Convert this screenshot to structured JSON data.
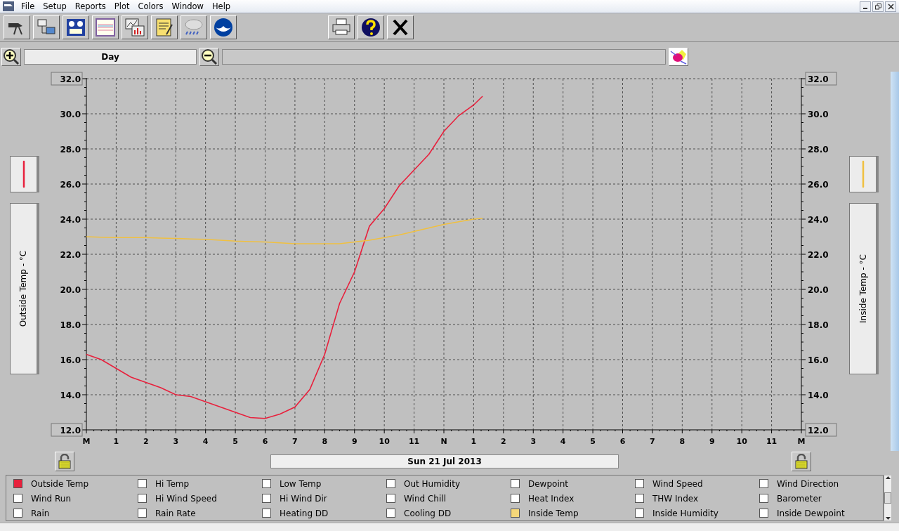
{
  "menu": [
    "File",
    "Setup",
    "Reports",
    "Plot",
    "Colors",
    "Window",
    "Help"
  ],
  "zoom_bar": {
    "period": "Day"
  },
  "left_axis": {
    "title": "Outside Temp - °C"
  },
  "right_axis": {
    "title": "Inside Temp - °C",
    "ticks": [
      "32.0",
      "30.0",
      "28.0",
      "26.0",
      "24.0",
      "22.0",
      "20.0",
      "18.0",
      "16.0",
      "14.0",
      "12.0"
    ]
  },
  "chart_data": {
    "type": "line",
    "x": [
      0,
      0.5,
      1,
      1.5,
      2,
      2.5,
      3,
      3.5,
      4,
      4.5,
      5,
      5.5,
      6,
      6.5,
      7,
      7.5,
      8,
      8.5,
      9,
      9.5,
      10,
      10.5,
      11,
      11.5,
      12,
      12.5,
      13,
      13.3
    ],
    "series": [
      {
        "color": "#e8203c",
        "values": [
          16.3,
          16.0,
          15.5,
          15.0,
          14.7,
          14.4,
          14.0,
          13.9,
          13.6,
          13.3,
          13.0,
          12.7,
          12.65,
          12.9,
          13.3,
          14.3,
          16.3,
          19.2,
          21.0,
          23.6,
          24.6,
          25.9,
          26.8,
          27.7,
          29.0,
          29.9,
          30.5,
          31.0
        ]
      },
      {
        "color": "#f0c040",
        "values": [
          23.0,
          22.97,
          22.95,
          22.95,
          22.95,
          22.92,
          22.9,
          22.87,
          22.85,
          22.8,
          22.75,
          22.72,
          22.7,
          22.65,
          22.6,
          22.6,
          22.6,
          22.6,
          22.7,
          22.8,
          22.95,
          23.1,
          23.3,
          23.5,
          23.7,
          23.85,
          24.0,
          24.05
        ]
      }
    ],
    "xlim": [
      0,
      24
    ],
    "ylim": [
      12,
      32
    ],
    "grid": true,
    "xticks": [
      1,
      2,
      3,
      4,
      5,
      6,
      7,
      8,
      9,
      10,
      11
    ],
    "yticks": [
      {
        "value": 32,
        "label": "32.0"
      },
      {
        "value": 30,
        "label": "30.0"
      },
      {
        "value": 28,
        "label": "28.0"
      },
      {
        "value": 26,
        "label": "26.0"
      },
      {
        "value": 24,
        "label": "24.0"
      },
      {
        "value": 22,
        "label": "22.0"
      },
      {
        "value": 20,
        "label": "20.0"
      },
      {
        "value": 18,
        "label": "18.0"
      },
      {
        "value": 16,
        "label": "16.0"
      },
      {
        "value": 14,
        "label": "14.0"
      },
      {
        "value": 12,
        "label": "12.0"
      }
    ]
  },
  "x_axis": {
    "start_label": "M",
    "noon_label": "N",
    "afternoon_labels": [
      "1",
      "2",
      "3",
      "4",
      "5",
      "6",
      "7",
      "8",
      "9",
      "10",
      "11"
    ],
    "end_label": "M"
  },
  "date": "Sun 21 Jul 2013",
  "legend": {
    "items": [
      {
        "label": "Outside Temp",
        "checked": true,
        "color": "#e8203c"
      },
      {
        "label": "Hi Temp",
        "checked": false
      },
      {
        "label": "Low Temp",
        "checked": false
      },
      {
        "label": "Out Humidity",
        "checked": false
      },
      {
        "label": "Dewpoint",
        "checked": false
      },
      {
        "label": "Wind Speed",
        "checked": false
      },
      {
        "label": "Wind Direction",
        "checked": false
      },
      {
        "label": "Wind Run",
        "checked": false
      },
      {
        "label": "Hi Wind Speed",
        "checked": false
      },
      {
        "label": "Hi Wind Dir",
        "checked": false
      },
      {
        "label": "Wind Chill",
        "checked": false
      },
      {
        "label": "Heat Index",
        "checked": false
      },
      {
        "label": "THW Index",
        "checked": false
      },
      {
        "label": "Barometer",
        "checked": false
      },
      {
        "label": "Rain",
        "checked": false
      },
      {
        "label": "Rain Rate",
        "checked": false
      },
      {
        "label": "Heating DD",
        "checked": false
      },
      {
        "label": "Cooling DD",
        "checked": false
      },
      {
        "label": "Inside Temp",
        "checked": true,
        "color": "#f5d77a"
      },
      {
        "label": "Inside Humidity",
        "checked": false
      },
      {
        "label": "Inside Dewpoint",
        "checked": false
      }
    ]
  }
}
